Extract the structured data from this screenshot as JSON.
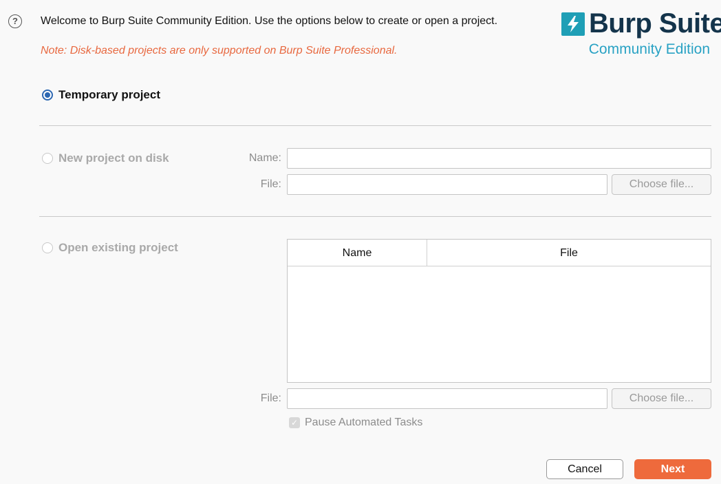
{
  "header": {
    "help_icon": "question-circle-icon",
    "welcome_text": "Welcome to Burp Suite Community Edition. Use the options below to create or open a project.",
    "note_text": "Note: Disk-based projects are only supported on Burp Suite Professional."
  },
  "logo": {
    "wordmark": "Burp Suite",
    "subtitle": "Community Edition",
    "icon": "lightning-bolt-icon"
  },
  "options": {
    "temporary": {
      "label": "Temporary project",
      "selected": true
    },
    "new_on_disk": {
      "label": "New project on disk",
      "name_label": "Name:",
      "name_value": "",
      "file_label": "File:",
      "file_value": "",
      "choose_label": "Choose file..."
    },
    "open_existing": {
      "label": "Open existing project",
      "columns": [
        "Name",
        "File"
      ],
      "rows": [],
      "file_label": "File:",
      "file_value": "",
      "choose_label": "Choose file...",
      "pause_label": "Pause Automated Tasks",
      "pause_checked": true
    }
  },
  "footer": {
    "cancel_label": "Cancel",
    "next_label": "Next"
  },
  "colors": {
    "accent_orange": "#ee6a3c",
    "radio_blue": "#2c67b2",
    "logo_teal": "#1f9fb6",
    "logo_navy": "#14344b"
  }
}
